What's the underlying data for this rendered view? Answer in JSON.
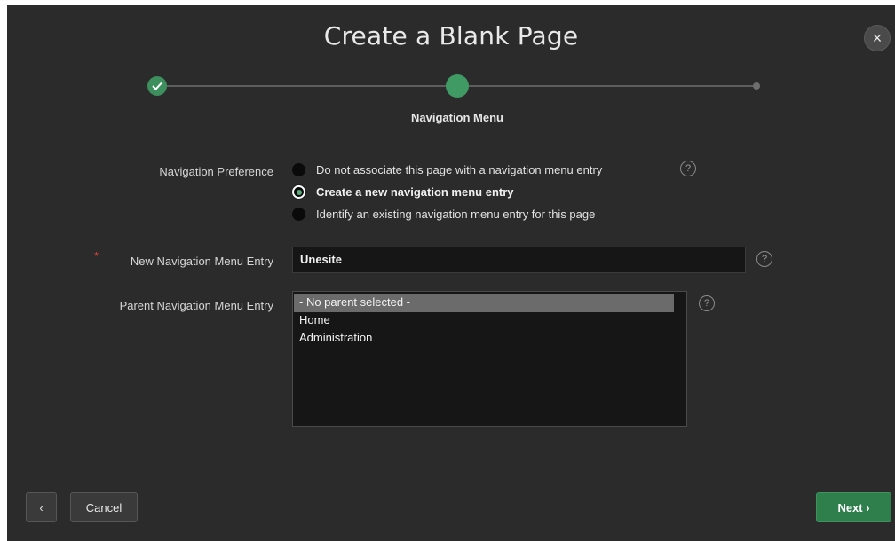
{
  "dialog": {
    "title": "Create a Blank Page",
    "close_glyph": "×"
  },
  "wizard": {
    "steps": [
      {
        "status": "done",
        "icon": "check-icon"
      },
      {
        "status": "current",
        "label": "Navigation Menu"
      },
      {
        "status": "future"
      }
    ],
    "accent_color": "#3f9a64"
  },
  "form": {
    "navigation_preference": {
      "label": "Navigation Preference",
      "options": [
        {
          "label": "Do not associate this page with a navigation menu entry",
          "selected": false
        },
        {
          "label": "Create a new navigation menu entry",
          "selected": true
        },
        {
          "label": "Identify an existing navigation menu entry for this page",
          "selected": false
        }
      ]
    },
    "new_entry": {
      "label": "New Navigation Menu Entry",
      "required_marker": "*",
      "value": "Unesite"
    },
    "parent_entry": {
      "label": "Parent Navigation Menu Entry",
      "options": [
        {
          "label": "- No parent selected -",
          "selected": true
        },
        {
          "label": "Home",
          "selected": false
        },
        {
          "label": "Administration",
          "selected": false
        }
      ]
    },
    "help_glyph": "?"
  },
  "footer": {
    "back_glyph": "‹",
    "cancel_label": "Cancel",
    "next_label": "Next ›"
  }
}
